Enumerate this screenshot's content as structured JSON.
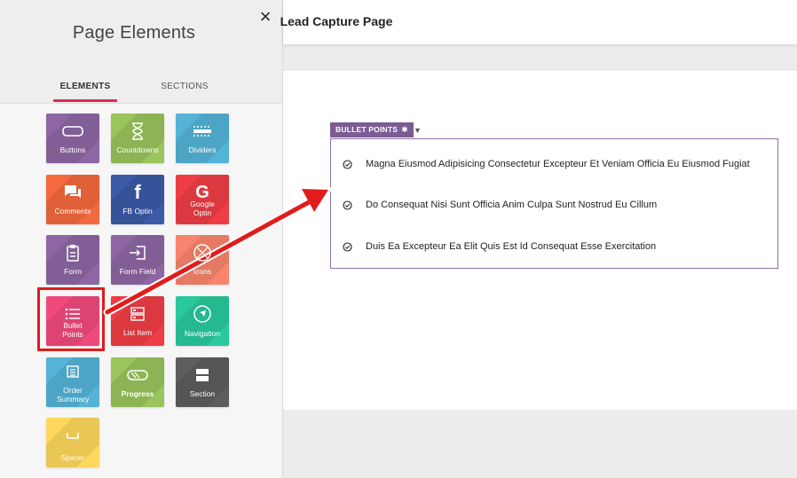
{
  "panel": {
    "title": "Page Elements",
    "tabs": {
      "elements": "ELEMENTS",
      "sections": "SECTIONS"
    },
    "tiles": {
      "buttons": "Buttons",
      "countdowns": "Countdowns",
      "dividers": "Dividers",
      "comments": "Comments",
      "fb_optin": "FB Optin",
      "google_optin": "Google Optin",
      "form": "Form",
      "form_field": "Form Field",
      "icons": "Icons",
      "bullet_points": "Bullet Points",
      "list_item": "List Item",
      "navigation": "Navigation",
      "order_summary": "Order Summary",
      "progress": "Progress",
      "section": "Section",
      "spacer": "Spacer"
    }
  },
  "header": {
    "title": "Lead Capture Page"
  },
  "widget": {
    "label": "BULLET POINTS",
    "items": [
      "Magna Eiusmod Adipisicing Consectetur Excepteur Et Veniam Officia Eu Eiusmod Fugiat",
      "Do Consequat Nisi Sunt Officia Anim Culpa Sunt Nostrud Eu Cillum",
      "Duis Ea Excepteur Ea Elit Quis Est Id Consequat Esse Exercitation"
    ]
  },
  "colors": {
    "accent": "#e02a55",
    "purple": "#8e66a3",
    "green": "#9ac45c",
    "blue": "#54b3d6",
    "orange": "#f4693d",
    "fb_blue": "#3b5ba6",
    "red": "#ee3d45",
    "salmon": "#f8846d",
    "pink": "#f04a7d",
    "teal": "#2ac99d",
    "gray": "#5d5d5d",
    "yellow": "#fdd85d",
    "highlight_red": "#e01c1c"
  }
}
